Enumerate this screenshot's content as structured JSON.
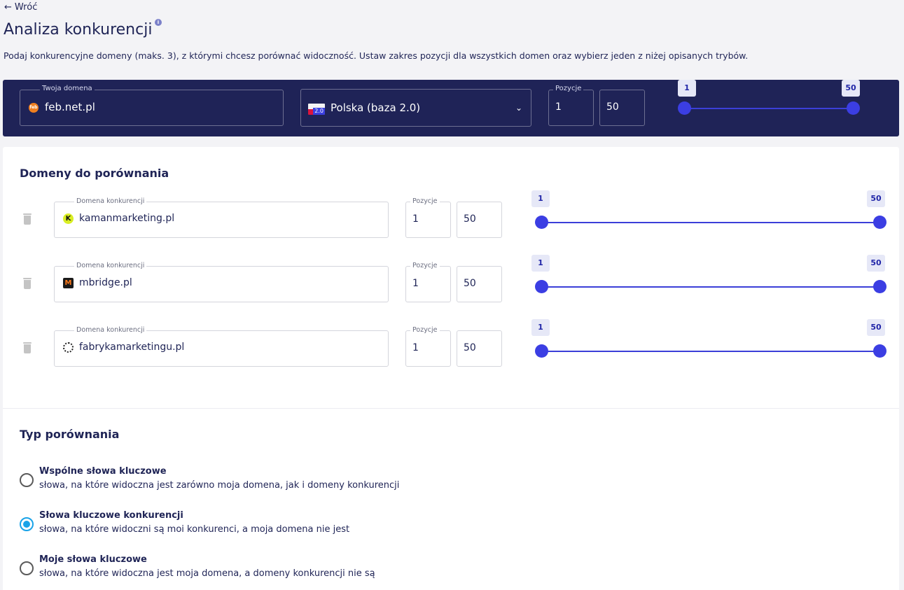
{
  "header": {
    "back_label": "Wróć",
    "back_arrow": "←",
    "title": "Analiza konkurencji",
    "info_icon": "i",
    "description": "Podaj konkurencyjne domeny (maks. 3), z którymi chcesz porównać widoczność. Ustaw zakres pozycji dla wszystkich domen oraz wybierz jeden z niżej opisanych trybów."
  },
  "top_bar": {
    "domain_legend": "Twoja domena",
    "domain_favicon_text": "feb",
    "domain_value": "feb.net.pl",
    "country_value": "Polska (baza 2.0)",
    "country_badge": "2.0",
    "positions_legend": "Pozycje",
    "pos_min": "1",
    "pos_max": "50",
    "slider_min_label": "1",
    "slider_max_label": "50"
  },
  "comparison": {
    "title": "Domeny do porównania",
    "domain_legend": "Domena konkurencji",
    "positions_legend": "Pozycje",
    "rows": [
      {
        "domain": "kamanmarketing.pl",
        "favicon": "K",
        "pos_min": "1",
        "pos_max": "50",
        "slider_min": "1",
        "slider_max": "50"
      },
      {
        "domain": "mbridge.pl",
        "favicon": "M",
        "pos_min": "1",
        "pos_max": "50",
        "slider_min": "1",
        "slider_max": "50"
      },
      {
        "domain": "fabrykamarketingu.pl",
        "favicon": "",
        "pos_min": "1",
        "pos_max": "50",
        "slider_min": "1",
        "slider_max": "50"
      }
    ]
  },
  "compare_type": {
    "title": "Typ porównania",
    "options": [
      {
        "title": "Wspólne słowa kluczowe",
        "desc": "słowa, na które widoczna jest zarówno moja domena, jak i domeny konkurencji",
        "checked": false
      },
      {
        "title": "Słowa kluczowe konkurencji",
        "desc": "słowa, na które widoczni są moi konkurenci, a moja domena nie jest",
        "checked": true
      },
      {
        "title": "Moje słowa kluczowe",
        "desc": "słowa, na które widoczna jest moja domena, a domeny konkurencji nie są",
        "checked": false
      }
    ]
  },
  "colors": {
    "navy": "#1f2357",
    "accent": "#3b3ee3",
    "radio_checked": "#1aa3e8"
  }
}
